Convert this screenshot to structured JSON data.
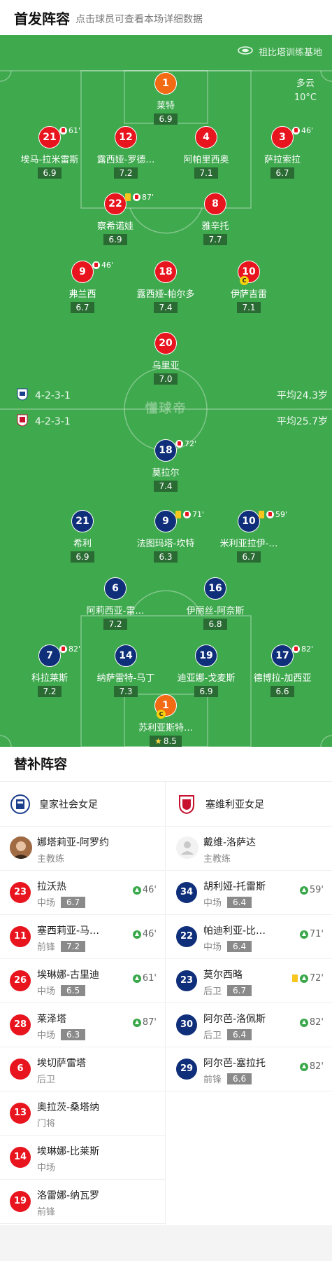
{
  "header": {
    "title": "首发阵容",
    "subtitle": "点击球员可查看本场详细数据"
  },
  "pitch": {
    "venue": "祖比塔训练基地",
    "weather": {
      "condition": "多云",
      "temperature": "10°C"
    },
    "watermark": "懂球帝",
    "home": {
      "formation": "4-2-3-1",
      "avg_age": "平均24.3岁"
    },
    "away": {
      "formation": "4-2-3-1",
      "avg_age": "平均25.7岁"
    },
    "home_players": [
      {
        "num": "1",
        "name": "莱特",
        "rating": "6.9"
      },
      {
        "num": "21",
        "name": "埃马-拉米雷斯",
        "rating": "6.9",
        "sub": "61'"
      },
      {
        "num": "12",
        "name": "露西娅-罗德…",
        "rating": "7.2"
      },
      {
        "num": "4",
        "name": "阿帕里西奥",
        "rating": "7.1"
      },
      {
        "num": "3",
        "name": "萨拉索拉",
        "rating": "6.7",
        "sub": "46'"
      },
      {
        "num": "22",
        "name": "察希诺娃",
        "rating": "6.9",
        "sub": "87'"
      },
      {
        "num": "8",
        "name": "雅辛托",
        "rating": "7.7"
      },
      {
        "num": "9",
        "name": "弗兰西",
        "rating": "6.7",
        "sub": "46'"
      },
      {
        "num": "18",
        "name": "露西娅-帕尔多",
        "rating": "7.4"
      },
      {
        "num": "10",
        "name": "伊萨吉雷",
        "rating": "7.1"
      },
      {
        "num": "20",
        "name": "乌里亚",
        "rating": "7.0"
      }
    ],
    "away_players": [
      {
        "num": "18",
        "name": "莫拉尔",
        "rating": "7.4",
        "sub": "72'"
      },
      {
        "num": "21",
        "name": "希利",
        "rating": "6.9"
      },
      {
        "num": "9",
        "name": "法图玛塔-坎特",
        "rating": "6.3",
        "sub": "71'"
      },
      {
        "num": "10",
        "name": "米利亚拉伊-…",
        "rating": "6.7",
        "sub": "59'"
      },
      {
        "num": "6",
        "name": "阿莉西亚-雷…",
        "rating": "7.2"
      },
      {
        "num": "16",
        "name": "伊丽丝-阿奈斯",
        "rating": "6.8"
      },
      {
        "num": "7",
        "name": "科拉莱斯",
        "rating": "7.2",
        "sub": "82'"
      },
      {
        "num": "14",
        "name": "纳萨雷特-马丁",
        "rating": "7.3"
      },
      {
        "num": "19",
        "name": "迪亚娜-戈麦斯",
        "rating": "6.9"
      },
      {
        "num": "17",
        "name": "德博拉-加西亚",
        "rating": "6.6",
        "sub": "82'"
      },
      {
        "num": "1",
        "name": "苏利亚斯特…",
        "rating": "8.5",
        "captain": "C"
      }
    ],
    "captain_mark": "C"
  },
  "subs": {
    "title": "替补阵容",
    "home": {
      "team": "皇家社会女足",
      "coach": {
        "name": "娜塔莉亚-阿罗约",
        "role": "主教练"
      },
      "players": [
        {
          "num": "23",
          "name": "拉沃热",
          "pos": "中场",
          "rating": "6.7",
          "event": "46'"
        },
        {
          "num": "11",
          "name": "塞西莉亚-马…",
          "pos": "前锋",
          "rating": "7.2",
          "event": "46'"
        },
        {
          "num": "26",
          "name": "埃琳娜-古里迪",
          "pos": "中场",
          "rating": "6.5",
          "event": "61'"
        },
        {
          "num": "28",
          "name": "莱泽塔",
          "pos": "中场",
          "rating": "6.3",
          "event": "87'"
        },
        {
          "num": "6",
          "name": "埃切萨雷塔",
          "pos": "后卫"
        },
        {
          "num": "13",
          "name": "奥拉茨-桑塔纳",
          "pos": "门将"
        },
        {
          "num": "14",
          "name": "埃琳娜-比莱斯",
          "pos": "中场"
        },
        {
          "num": "19",
          "name": "洛雷娜-纳瓦罗",
          "pos": "前锋"
        }
      ]
    },
    "away": {
      "team": "塞维利亚女足",
      "coach": {
        "name": "戴维-洛萨达",
        "role": "主教练"
      },
      "players": [
        {
          "num": "34",
          "name": "胡利娅-托雷斯",
          "pos": "中场",
          "rating": "6.4",
          "event": "59'"
        },
        {
          "num": "22",
          "name": "帕迪利亚-比…",
          "pos": "中场",
          "rating": "6.4",
          "event": "71'"
        },
        {
          "num": "23",
          "name": "莫尔西略",
          "pos": "后卫",
          "rating": "6.7",
          "event": "72'"
        },
        {
          "num": "30",
          "name": "阿尔芭-洛佩斯",
          "pos": "后卫",
          "rating": "6.4",
          "event": "82'"
        },
        {
          "num": "29",
          "name": "阿尔芭-塞拉托",
          "pos": "前锋",
          "rating": "6.6",
          "event": "82'"
        }
      ]
    }
  },
  "colors": {
    "pitch": "#3fa94e",
    "home": "#e8141e",
    "away": "#0f2f7a",
    "goalkeeper": "#f36a14"
  }
}
